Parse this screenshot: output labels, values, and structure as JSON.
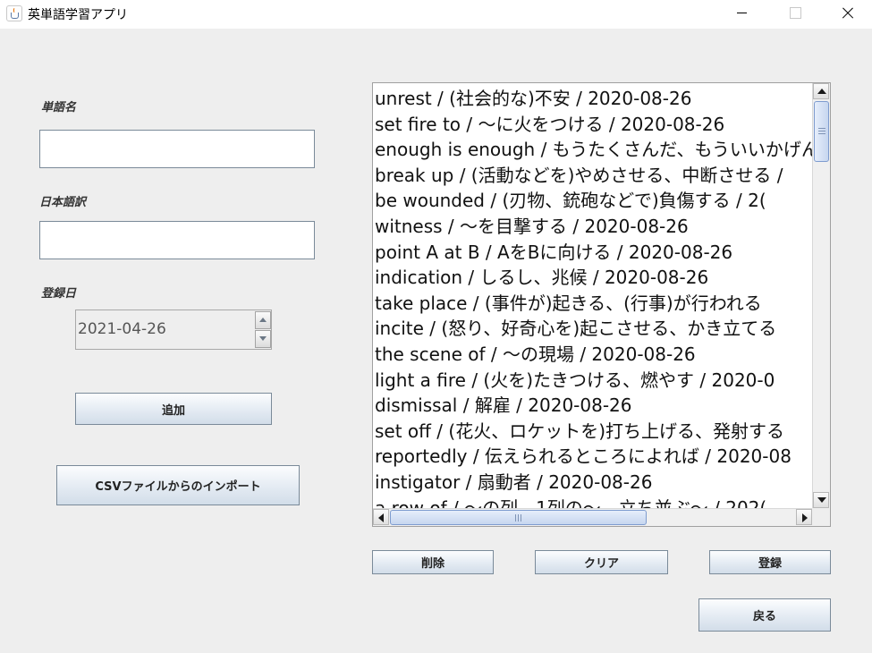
{
  "window": {
    "title": "英単語学習アプリ"
  },
  "form": {
    "word_label": "単語名",
    "word_value": "",
    "translation_label": "日本語訳",
    "translation_value": "",
    "date_label": "登録日",
    "date_value": "2021-04-26",
    "add_button": "追加",
    "import_button": "CSVファイルからのインポート"
  },
  "list": {
    "items": [
      "unrest / (社会的な)不安 / 2020-08-26",
      "set fire to / ～に火をつける / 2020-08-26",
      "enough is enough / もうたくさんだ、もういいかげん",
      "break up / (活動などを)やめさせる、中断させる /",
      "be wounded / (刃物、銃砲などで)負傷する / 2(",
      "witness / ～を目撃する / 2020-08-26",
      "point A at B / AをBに向ける / 2020-08-26",
      "indication / しるし、兆候 / 2020-08-26",
      "take place / (事件が)起きる、(行事)が行われる",
      "incite / (怒り、好奇心を)起こさせる、かき立てる",
      "the scene of / ～の現場 / 2020-08-26",
      "light a fire / (火を)たきつける、燃やす / 2020-0",
      "dismissal / 解雇 / 2020-08-26",
      "set off / (花火、ロケットを)打ち上げる、発射する",
      "reportedly / 伝えられるところによれば / 2020-08",
      "instigator / 扇動者 / 2020-08-26",
      "a row of / ～の列、1列の～、立ち並ぶ～ / 202("
    ]
  },
  "actions": {
    "delete": "削除",
    "clear": "クリア",
    "register": "登録",
    "back": "戻る"
  }
}
